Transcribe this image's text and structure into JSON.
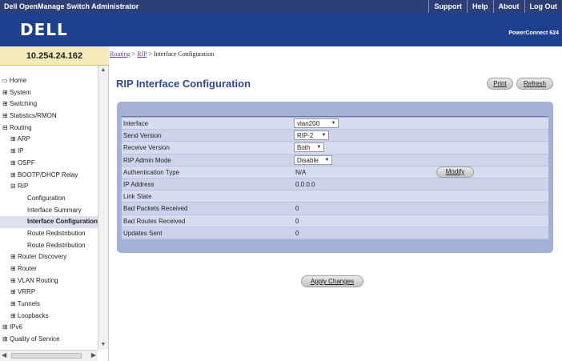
{
  "header": {
    "app_title": "Dell OpenManage Switch Administrator",
    "links": [
      "Support",
      "Help",
      "About",
      "Log Out"
    ],
    "logo": "DELL",
    "product": "PowerConnect 624"
  },
  "ip_address": "10.254.24.162",
  "breadcrumb": {
    "part1": "Routing",
    "sep": ">",
    "part2": "RIP",
    "current": "Interface Configuration"
  },
  "sidebar": {
    "items": [
      "Home",
      "System",
      "Switching",
      "Statistics/RMON",
      "Routing",
      "ARP",
      "IP",
      "OSPF",
      "BOOTP/DHCP Relay",
      "RIP",
      "Configuration",
      "Interface Summary",
      "Interface Configuration",
      "Route Redistribution",
      "Route Redistribution",
      "Router Discovery",
      "Router",
      "VLAN Routing",
      "VRRP",
      "Tunnels",
      "Loopbacks",
      "IPv6",
      "Quality of Service"
    ]
  },
  "page": {
    "title": "RIP Interface Configuration",
    "print_label": "Print",
    "refresh_label": "Refresh",
    "modify_label": "Modify",
    "apply_label": "Apply Changes"
  },
  "form": {
    "interface": {
      "label": "Interface",
      "value": "vlan200"
    },
    "send_version": {
      "label": "Send Version",
      "value": "RIP-2"
    },
    "receive_version": {
      "label": "Receive Version",
      "value": "Both"
    },
    "admin_mode": {
      "label": "RIP Admin Mode",
      "value": "Disable"
    },
    "auth_type": {
      "label": "Authentication Type",
      "value": "N/A"
    },
    "ip_address": {
      "label": "IP Address",
      "value": "0.0.0.0"
    },
    "link_state": {
      "label": "Link State",
      "value": ""
    },
    "bad_packets": {
      "label": "Bad Packets Received",
      "value": "0"
    },
    "bad_routes": {
      "label": "Bad Routes Received",
      "value": "0"
    },
    "updates_sent": {
      "label": "Updates Sent",
      "value": "0"
    }
  },
  "colors": {
    "topbar": "#2d3f77",
    "banner": "#1e3f8e",
    "panel": "#a4b1d6",
    "title": "#2d4a8e"
  }
}
